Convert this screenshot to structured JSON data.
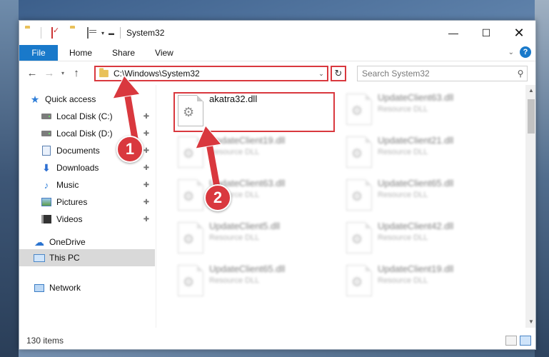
{
  "window": {
    "title": "System32",
    "minimize_glyph": "—",
    "maximize_glyph": "☐",
    "close_glyph": "✕"
  },
  "ribbon": {
    "tabs": [
      "File",
      "Home",
      "Share",
      "View"
    ],
    "help_glyph": "?"
  },
  "address": {
    "path": "C:\\Windows\\System32",
    "search_placeholder": "Search System32"
  },
  "nav": {
    "items": [
      {
        "label": "Quick access",
        "icon": "star-icon",
        "pinned": false
      },
      {
        "label": "Local Disk (C:)",
        "icon": "drive-icon",
        "pinned": true
      },
      {
        "label": "Local Disk (D:)",
        "icon": "drive-icon",
        "pinned": true
      },
      {
        "label": "Documents",
        "icon": "documents-icon",
        "pinned": true
      },
      {
        "label": "Downloads",
        "icon": "download-icon",
        "pinned": true
      },
      {
        "label": "Music",
        "icon": "music-icon",
        "pinned": true
      },
      {
        "label": "Pictures",
        "icon": "pictures-icon",
        "pinned": true
      },
      {
        "label": "Videos",
        "icon": "videos-icon",
        "pinned": true
      },
      {
        "label": "OneDrive",
        "icon": "cloud-icon",
        "pinned": false
      },
      {
        "label": "This PC",
        "icon": "computer-icon",
        "pinned": false,
        "selected": true
      },
      {
        "label": "Network",
        "icon": "network-icon",
        "pinned": false
      }
    ]
  },
  "files": {
    "highlighted": {
      "name": "akatra32.dll",
      "type": ""
    },
    "left": [
      {
        "name": "UpdateClient19.dll",
        "type": "Resource DLL"
      },
      {
        "name": "UpdateClient63.dll",
        "type": "Resource DLL"
      },
      {
        "name": "UpdateClient5.dll",
        "type": "Resource DLL"
      },
      {
        "name": "UpdateClient65.dll",
        "type": "Resource DLL"
      }
    ],
    "right": [
      {
        "name": "UpdateClient63.dll",
        "type": "Resource DLL"
      },
      {
        "name": "UpdateClient21.dll",
        "type": "Resource DLL"
      },
      {
        "name": "UpdateClient65.dll",
        "type": "Resource DLL"
      },
      {
        "name": "UpdateClient42.dll",
        "type": "Resource DLL"
      },
      {
        "name": "UpdateClient19.dll",
        "type": "Resource DLL"
      }
    ]
  },
  "status": {
    "item_count": "130 items"
  },
  "annotations": {
    "callout_1": "1",
    "callout_2": "2",
    "color": "#d9383e"
  }
}
